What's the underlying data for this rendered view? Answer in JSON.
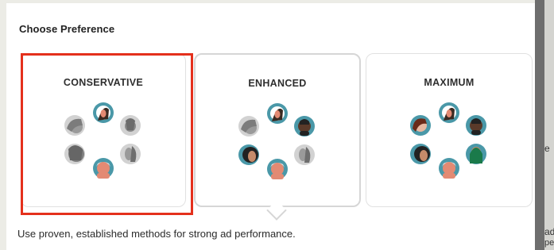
{
  "preference": {
    "title": "Choose Preference",
    "options": [
      {
        "label": "CONSERVATIVE",
        "selected": true
      },
      {
        "label": "ENHANCED",
        "selected": false
      },
      {
        "label": "MAXIMUM",
        "selected": false
      }
    ],
    "description": "Use proven, established methods for strong ad performance."
  },
  "background_panel": {
    "fragments": [
      "e",
      "ad",
      "pe"
    ]
  },
  "colors": {
    "selection_outline": "#e4301c",
    "avatar_teal": "#4a98a8",
    "avatar_gray": "#cfcfcf",
    "skin_tone": "#e38a73"
  }
}
